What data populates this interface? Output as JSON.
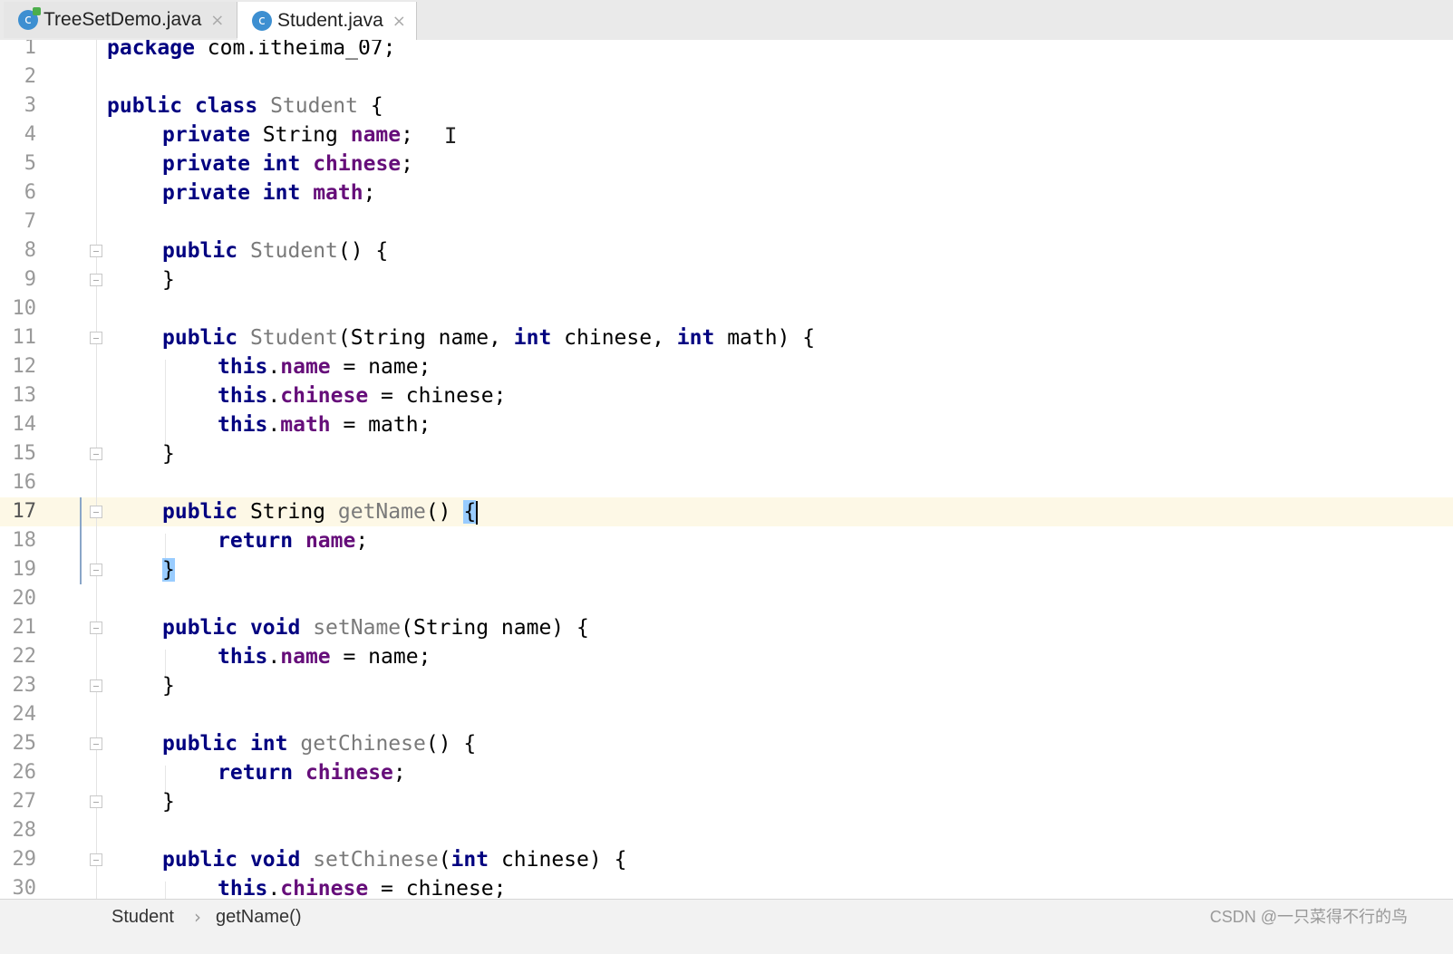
{
  "tabs": [
    {
      "label": "TreeSetDemo.java",
      "icon": "java-class-icon",
      "close": "×"
    },
    {
      "label": "Student.java",
      "icon": "java-class-icon",
      "close": "×"
    }
  ],
  "tab_icon_letter": "c",
  "editor": {
    "current_line": 17,
    "lines": [
      {
        "n": "1"
      },
      {
        "n": "2"
      },
      {
        "n": "3"
      },
      {
        "n": "4"
      },
      {
        "n": "5"
      },
      {
        "n": "6"
      },
      {
        "n": "7"
      },
      {
        "n": "8"
      },
      {
        "n": "9"
      },
      {
        "n": "10"
      },
      {
        "n": "11"
      },
      {
        "n": "12"
      },
      {
        "n": "13"
      },
      {
        "n": "14"
      },
      {
        "n": "15"
      },
      {
        "n": "16"
      },
      {
        "n": "17"
      },
      {
        "n": "18"
      },
      {
        "n": "19"
      },
      {
        "n": "20"
      },
      {
        "n": "21"
      },
      {
        "n": "22"
      },
      {
        "n": "23"
      },
      {
        "n": "24"
      },
      {
        "n": "25"
      },
      {
        "n": "26"
      },
      {
        "n": "27"
      },
      {
        "n": "28"
      },
      {
        "n": "29"
      },
      {
        "n": "30"
      }
    ],
    "code": {
      "l1": [
        "package",
        " com.itheima_07;"
      ],
      "l3": [
        "public",
        " ",
        "class",
        " ",
        "Student",
        " {"
      ],
      "l4": [
        "private",
        " String ",
        "name",
        ";"
      ],
      "l5": [
        "private",
        " ",
        "int",
        " ",
        "chinese",
        ";"
      ],
      "l6": [
        "private",
        " ",
        "int",
        " ",
        "math",
        ";"
      ],
      "l8": [
        "public",
        " ",
        "Student",
        "() {"
      ],
      "l9": [
        "}"
      ],
      "l11": [
        "public",
        " ",
        "Student",
        "(String name, ",
        "int",
        " chinese, ",
        "int",
        " math) {"
      ],
      "l12": [
        "this",
        ".",
        "name",
        " = name;"
      ],
      "l13": [
        "this",
        ".",
        "chinese",
        " = chinese;"
      ],
      "l14": [
        "this",
        ".",
        "math",
        " = math;"
      ],
      "l15": [
        "}"
      ],
      "l17": [
        "public",
        " String ",
        "getName",
        "() ",
        "{"
      ],
      "l18": [
        "return",
        " ",
        "name",
        ";"
      ],
      "l19": [
        "}"
      ],
      "l21": [
        "public",
        " ",
        "void",
        " ",
        "setName",
        "(String name) {"
      ],
      "l22": [
        "this",
        ".",
        "name",
        " = name;"
      ],
      "l23": [
        "}"
      ],
      "l25": [
        "public",
        " ",
        "int",
        " ",
        "getChinese",
        "() {"
      ],
      "l26": [
        "return",
        " ",
        "chinese",
        ";"
      ],
      "l27": [
        "}"
      ],
      "l29": [
        "public",
        " ",
        "void",
        " ",
        "setChinese",
        "(",
        "int",
        " chinese) {"
      ],
      "l30": [
        "this",
        ".",
        "chinese",
        " = chinese;"
      ]
    }
  },
  "breadcrumb": {
    "items": [
      "Student",
      "getName()"
    ],
    "separator": "›"
  },
  "watermark": "CSDN @一只菜得不行的鸟",
  "colors": {
    "keyword": "#000080",
    "field": "#660e7a",
    "unused_name": "#7a7a7a",
    "current_line_bg": "#fdf8e6",
    "brace_match": "#99ccff"
  }
}
